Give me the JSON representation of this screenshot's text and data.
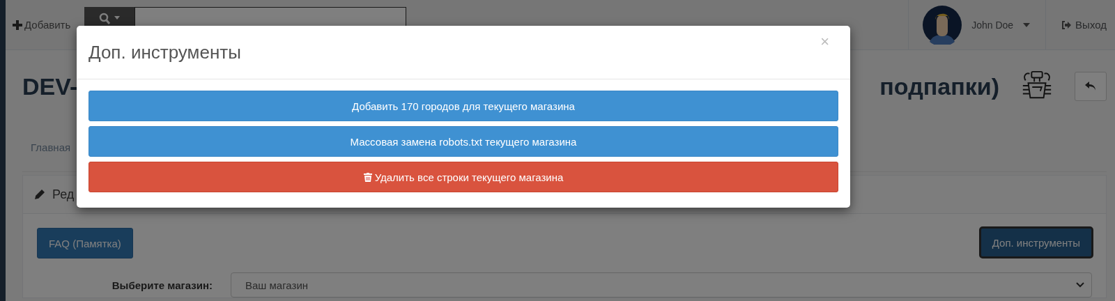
{
  "navbar": {
    "add_button": "Добавить",
    "user": {
      "name": "John Doe"
    },
    "logout": "Выход"
  },
  "page": {
    "title_parts": [
      "DEV-",
      "подпапки)"
    ],
    "breadcrumb": "Главная",
    "panel": {
      "title": "Ред",
      "faq_button": "FAQ (Памятка)",
      "tools_button": "Доп. инструменты",
      "store_label": "Выберите магазин:",
      "store_select": {
        "value": "Ваш магазин"
      }
    }
  },
  "modal": {
    "title": "Доп. инструменты",
    "close": "×",
    "buttons": [
      {
        "label": "Добавить 170 городов для текущего магазина",
        "kind": "primary"
      },
      {
        "label": "Массовая замена robots.txt текущего магазина",
        "kind": "primary"
      },
      {
        "label": "Удалить все строки текущего магазина",
        "kind": "danger"
      }
    ]
  }
}
